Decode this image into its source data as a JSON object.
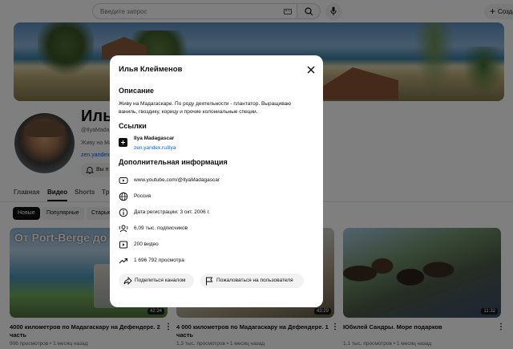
{
  "search": {
    "placeholder": "Введите запрос"
  },
  "header": {
    "create_label": "Создать"
  },
  "channel": {
    "name": "Илья",
    "handle": "@IlyaMada",
    "description": "Живу на Мад",
    "link": "zen.yandex",
    "subscribe_label": "Вы п"
  },
  "tabs": [
    {
      "label": "Главная"
    },
    {
      "label": "Видео"
    },
    {
      "label": "Shorts"
    },
    {
      "label": "Тр"
    }
  ],
  "chips": [
    {
      "label": "Новые"
    },
    {
      "label": "Популярные"
    },
    {
      "label": "Старые"
    }
  ],
  "videos": [
    {
      "thumb_text": "От Port-Berge до",
      "duration": "42:34",
      "title": "4000 километров по Мадагаскару на Дефендере. 2 часть",
      "meta": "906 просмотров • 1 месяц назад"
    },
    {
      "duration": "43:29",
      "title": "4 000 километров по Мадагаскару на Дефендере. 1 часть",
      "meta": "1,3 тыс. просмотров • 1 месяц назад"
    },
    {
      "duration": "11:32",
      "title": "Юбилей Сандры. Море подарков",
      "meta": "1,1 тыс. просмотров • 1 месяц назад"
    }
  ],
  "modal": {
    "title": "Илья Клейменов",
    "description_title": "Описание",
    "description": "Живу на Мадагаскаре. По роду деятельности - плантатор. Выращиваю ваниль, гвоздику, корицу и прочие колониальные специи.",
    "links_title": "Ссылки",
    "link_name": "Ilya Madagascar",
    "link_url": "zen.yandex.ru/ilya",
    "more_title": "Дополнительная информация",
    "info": [
      {
        "icon": "globe-link-icon",
        "text": "www.youtube.com/@IlyaMadagascar"
      },
      {
        "icon": "globe-icon",
        "text": "Россия"
      },
      {
        "icon": "info-icon",
        "text": "Дата регистрации: 3 окт. 2006 г."
      },
      {
        "icon": "subscribers-icon",
        "text": "6,09 тыс. подписчиков"
      },
      {
        "icon": "video-icon",
        "text": "200 видео"
      },
      {
        "icon": "trending-icon",
        "text": "1 696 792 просмотра"
      }
    ],
    "share_label": "Поделиться каналом",
    "report_label": "Пожаловаться на пользователя"
  }
}
